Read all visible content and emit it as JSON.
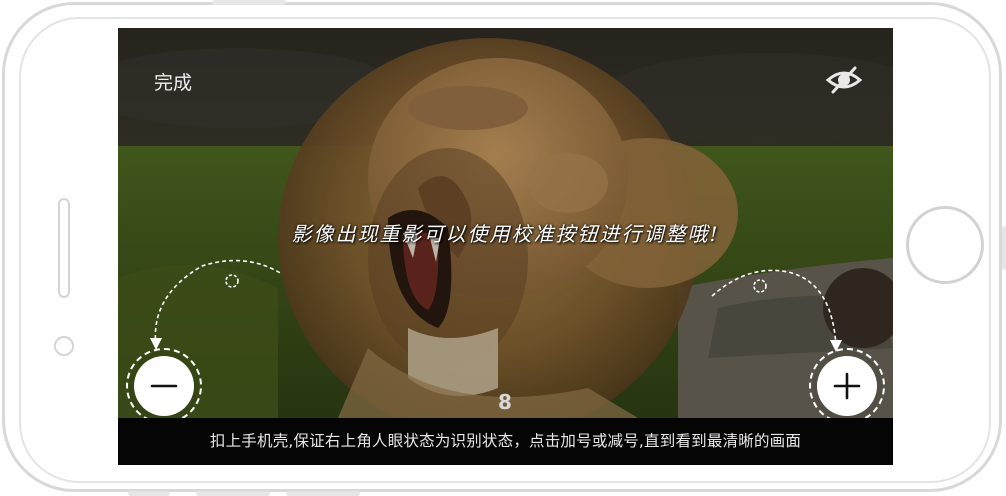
{
  "header": {
    "done_label": "完成",
    "eye_icon": "eye-off-icon"
  },
  "hint_text": "影像出现重影可以使用校准按钮进行调整哦!",
  "counter_value": "8",
  "instruction_text": "扣上手机壳,保证右上角人眼状态为识别状态，点击加号或减号,直到看到最清晰的画面",
  "controls": {
    "minus_icon": "minus-icon",
    "plus_icon": "plus-icon"
  },
  "colors": {
    "screen_bg": "#2c2a24",
    "bottom_bar": "#050505",
    "button_fill": "#ffffff",
    "text": "#ffffff"
  }
}
